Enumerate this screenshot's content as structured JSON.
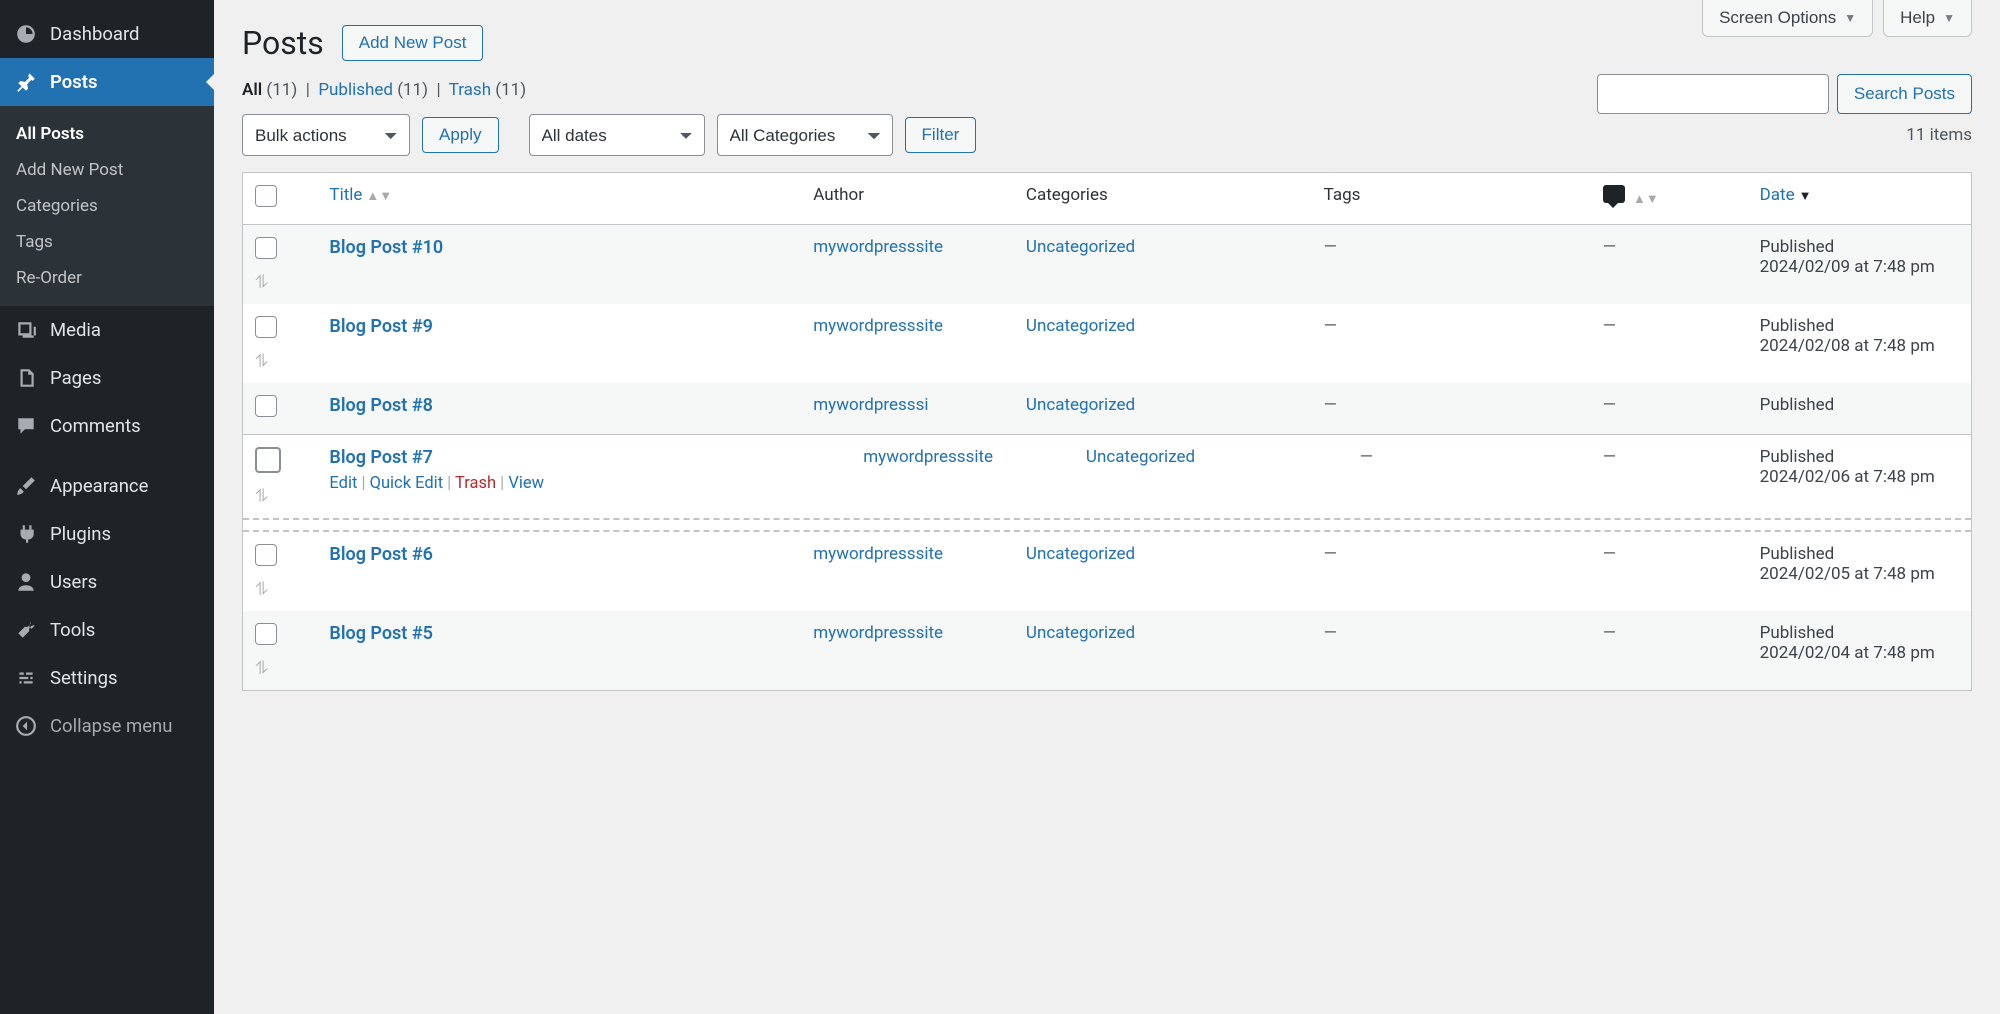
{
  "topButtons": {
    "screenOptions": "Screen Options",
    "help": "Help"
  },
  "sidebar": {
    "items": [
      {
        "label": "Dashboard",
        "icon": "dashboard-icon"
      },
      {
        "label": "Posts",
        "icon": "pin-icon",
        "current": true
      },
      {
        "label": "Media",
        "icon": "media-icon"
      },
      {
        "label": "Pages",
        "icon": "pages-icon"
      },
      {
        "label": "Comments",
        "icon": "comment-icon"
      },
      {
        "label": "Appearance",
        "icon": "brush-icon"
      },
      {
        "label": "Plugins",
        "icon": "plug-icon"
      },
      {
        "label": "Users",
        "icon": "user-icon"
      },
      {
        "label": "Tools",
        "icon": "wrench-icon"
      },
      {
        "label": "Settings",
        "icon": "settings-icon"
      }
    ],
    "submenu": [
      "All Posts",
      "Add New Post",
      "Categories",
      "Tags",
      "Re-Order"
    ],
    "collapse": "Collapse menu"
  },
  "header": {
    "title": "Posts",
    "addNew": "Add New Post"
  },
  "filters": {
    "all": {
      "label": "All",
      "count": "(11)"
    },
    "published": {
      "label": "Published",
      "count": "(11)"
    },
    "trash": {
      "label": "Trash",
      "count": "(11)"
    }
  },
  "search": {
    "button": "Search Posts"
  },
  "tablenav": {
    "bulk": "Bulk actions",
    "apply": "Apply",
    "dates": "All dates",
    "cats": "All Categories",
    "filter": "Filter",
    "itemsCount": "11 items"
  },
  "columns": {
    "title": "Title",
    "author": "Author",
    "categories": "Categories",
    "tags": "Tags",
    "date": "Date"
  },
  "rowActions": {
    "edit": "Edit",
    "quickEdit": "Quick Edit",
    "trash": "Trash",
    "view": "View"
  },
  "rows": [
    {
      "title": "Blog Post #10",
      "author": "mywordpresssite",
      "category": "Uncategorized",
      "tags": "—",
      "comments": "—",
      "dateStatus": "Published",
      "dateLine": "2024/02/09 at 7:48 pm"
    },
    {
      "title": "Blog Post #9",
      "author": "mywordpresssite",
      "category": "Uncategorized",
      "tags": "—",
      "comments": "—",
      "dateStatus": "Published",
      "dateLine": "2024/02/08 at 7:48 pm"
    },
    {
      "title": "Blog Post #8",
      "author": "mywordpresssi",
      "category": "Uncategorized",
      "tags": "—",
      "comments": "—",
      "dateStatus": "Published",
      "dateLine": ""
    },
    {
      "title": "Blog Post #7",
      "author": "mywordpresssite",
      "category": "Uncategorized",
      "tags": "—",
      "comments": "—",
      "dateStatus": "Published",
      "dateLine": "2024/02/06 at 7:48 pm"
    },
    {
      "title": "Blog Post #6",
      "author": "mywordpresssite",
      "category": "Uncategorized",
      "tags": "—",
      "comments": "—",
      "dateStatus": "Published",
      "dateLine": "2024/02/05 at 7:48 pm"
    },
    {
      "title": "Blog Post #5",
      "author": "mywordpresssite",
      "category": "Uncategorized",
      "tags": "—",
      "comments": "—",
      "dateStatus": "Published",
      "dateLine": "2024/02/04 at 7:48 pm"
    }
  ]
}
